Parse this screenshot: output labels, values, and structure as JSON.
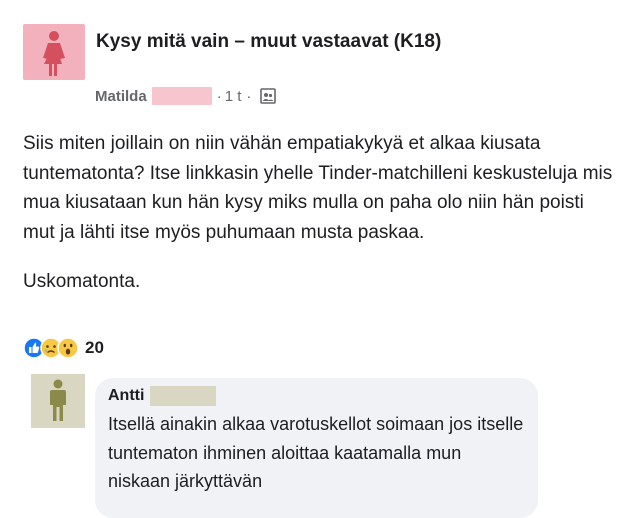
{
  "post": {
    "group_title": "Kysy mitä vain – muut vastaavat (K18)",
    "author": "Matilda",
    "time": "1 t",
    "separator": "·",
    "audience_icon": "group-audience-icon",
    "paragraphs": [
      "Siis miten joillain on niin vähän empatiakykyä et alkaa kiusata tuntematonta? Itse linkkasin yhelle Tinder-matchilleni keskusteluja mis mua kiusataan kun hän kysy miks mulla on paha olo niin hän poisti mut ja lähti itse myös puhumaan musta paskaa.",
      "Uskomatonta."
    ],
    "reactions": {
      "icons": [
        "like-icon",
        "sad-icon",
        "wow-icon"
      ],
      "count": "20"
    }
  },
  "comment": {
    "author": "Antti",
    "text": "Itsellä ainakin alkaa varotuskellot soimaan jos itselle tuntematon ihminen aloittaa kaatamalla mun niskaan järkyttävän"
  },
  "colors": {
    "avatar_bg": "#f2b1bd",
    "avatar_figure": "#d4505f",
    "comment_avatar_bg": "#d9d6c1",
    "comment_avatar_figure": "#8c8a4a",
    "bubble_bg": "#f0f2f5",
    "like_blue": "#1877f2",
    "reaction_yellow": "#f7c843"
  }
}
